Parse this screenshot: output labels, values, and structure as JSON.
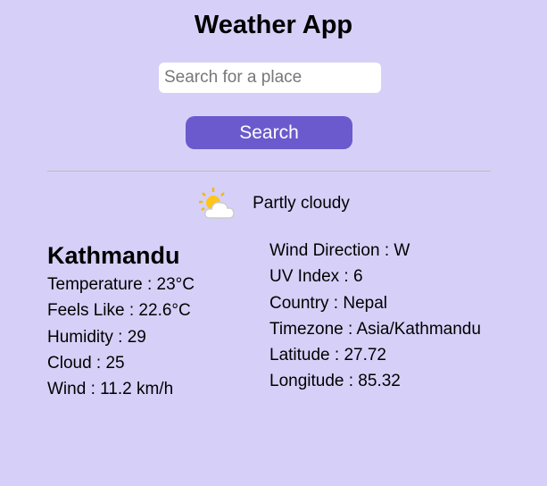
{
  "title": "Weather App",
  "search": {
    "placeholder": "Search for a place",
    "button": "Search"
  },
  "condition": {
    "icon": "partly-cloudy-icon",
    "text": "Partly cloudy"
  },
  "city": "Kathmandu",
  "left": [
    "Temperature : 23°C",
    "Feels Like : 22.6°C",
    "Humidity : 29",
    "Cloud : 25",
    "Wind : 11.2 km/h"
  ],
  "right": [
    "Wind Direction : W",
    "UV Index : 6",
    "Country : Nepal",
    "Timezone : Asia/Kathmandu",
    "Latitude : 27.72",
    "Longitude : 85.32"
  ]
}
